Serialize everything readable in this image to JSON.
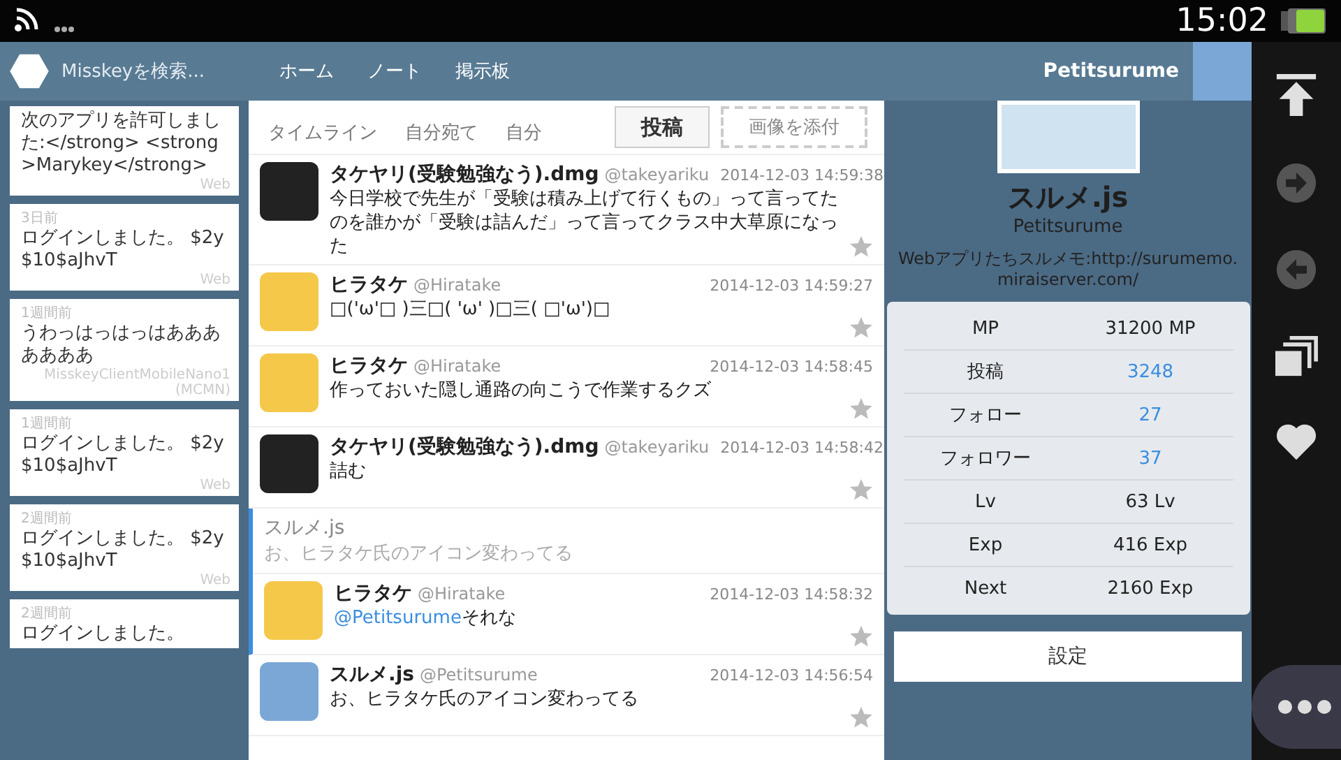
{
  "status_bar": {
    "time": "15:02"
  },
  "header": {
    "search_placeholder": "Misskeyを検索...",
    "nav": [
      {
        "label": "ホーム"
      },
      {
        "label": "ノート"
      },
      {
        "label": "掲示板"
      }
    ],
    "user_name": "Petitsurume"
  },
  "notifications": [
    {
      "text": "次のアプリを許可しました:</strong> <strong>Marykey</strong>",
      "source": "Web"
    },
    {
      "time": "3日前",
      "text": "ログインしました。 $2y$10$aJhvT",
      "source": "Web"
    },
    {
      "time": "1週間前",
      "text": "うわっはっはっはあああああああ",
      "source": "MisskeyClientMobileNano1 (MCMN)"
    },
    {
      "time": "1週間前",
      "text": "ログインしました。 $2y$10$aJhvT",
      "source": "Web"
    },
    {
      "time": "2週間前",
      "text": "ログインしました。 $2y$10$aJhvT",
      "source": "Web"
    },
    {
      "time": "2週間前",
      "text": "ログインしました。"
    }
  ],
  "timeline": {
    "tabs": [
      {
        "label": "タイムライン",
        "selected": false
      },
      {
        "label": "自分宛て",
        "selected": false
      },
      {
        "label": "自分",
        "selected": false
      }
    ],
    "buttons": [
      {
        "label": "投稿",
        "kind": "solid"
      },
      {
        "label": "画像を添付",
        "kind": "dashed"
      }
    ],
    "posts": [
      {
        "color": "#222222",
        "name": "タケヤリ(受験勉強なう).dmg",
        "handle": "@takeyariku",
        "date": "2014-12-03 14:59:38",
        "text": "今日学校で先生が「受験は積み上げて行くもの」って言ってたのを誰かが「受験は詰んだ」って言ってクラス中大草原になった"
      },
      {
        "color": "#f5c84a",
        "name": "ヒラタケ",
        "handle": "@Hiratake",
        "date": "2014-12-03 14:59:27",
        "text": "□('ω'□ )三□( 'ω' )□三( □'ω')□"
      },
      {
        "color": "#f5c84a",
        "name": "ヒラタケ",
        "handle": "@Hiratake",
        "date": "2014-12-03 14:58:45",
        "text": "作っておいた隠し通路の向こうで作業するクズ"
      },
      {
        "color": "#222222",
        "name": "タケヤリ(受験勉強なう).dmg",
        "handle": "@takeyariku",
        "date": "2014-12-03 14:58:42",
        "text": "詰む"
      },
      {
        "color": "#f5c84a",
        "name": "ヒラタケ",
        "handle": "@Hiratake",
        "date": "2014-12-03 14:58:32",
        "reply_to": {
          "name": "スルメ.js",
          "text": "お、ヒラタケ氏のアイコン変わってる"
        },
        "mention": "@Petitsurume",
        "text": "それな"
      },
      {
        "color": "#7aa7d6",
        "name": "スルメ.js",
        "handle": "@Petitsurume",
        "date": "2014-12-03 14:56:54",
        "text": "お、ヒラタケ氏のアイコン変わってる"
      }
    ]
  },
  "profile": {
    "name": "スルメ.js",
    "username": "Petitsurume",
    "bio": "Webアプリたちスルメモ:http://surumemo.miraiserver.com/",
    "stats": [
      {
        "label": "MP",
        "value": "31200 MP",
        "kind": "plain"
      },
      {
        "label": "投稿",
        "value": "3248",
        "kind": "link"
      },
      {
        "label": "フォロー",
        "value": "27",
        "kind": "link"
      },
      {
        "label": "フォロワー",
        "value": "37",
        "kind": "link"
      },
      {
        "label": "Lv",
        "value": "63 Lv",
        "kind": "plain"
      },
      {
        "label": "Exp",
        "value": "416 Exp",
        "kind": "plain"
      },
      {
        "label": "Next",
        "value": "2160 Exp",
        "kind": "plain"
      }
    ],
    "settings_label": "設定"
  }
}
